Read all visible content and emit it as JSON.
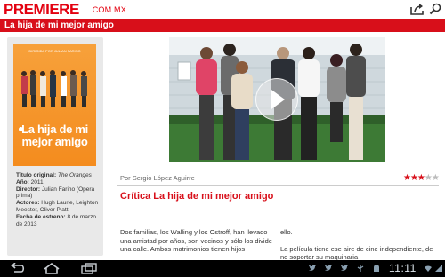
{
  "header": {
    "brand": "PREMIERE",
    "brand_suffix": ".COM.MX"
  },
  "titlebar": {
    "title": "La hija de mi mejor amigo"
  },
  "poster": {
    "tagline": "DIRIGIDA POR JULIAN FARINO",
    "title_line1": "La hija de mi",
    "title_line2": "mejor amigo"
  },
  "info": {
    "original_title_label": "Título original:",
    "original_title": "The Oranges",
    "year_label": "Año:",
    "year": "2011",
    "director_label": "Director:",
    "director": "Julian Farino (Opera prima)",
    "cast_label": "Actores:",
    "cast": "Hugh Laurie, Leighton Meester, Oliver Platt.",
    "release_label": "Fecha de estreno:",
    "release": "8 de marzo de 2013"
  },
  "article": {
    "byline": "Por Sergio López Aguirre",
    "rating": 3,
    "rating_max": 5,
    "headline": "Crítica La hija de mi mejor amigo",
    "col1": "Dos familias, los Walling y los Ostroff, han llevado una amistad por años, son vecinos y sólo los divide una calle. Ambos matrimonios tienen hijos",
    "col2_p1": "ello.",
    "col2_p2": "La película tiene ese aire de cine independiente, de no soportar su maquinaria"
  },
  "status": {
    "time": "11:11"
  },
  "colors": {
    "brand_red": "#e3000f",
    "title_bar": "#d80f1a",
    "system_bar": "#000000"
  },
  "icons": [
    "share-icon",
    "search-icon",
    "play-icon",
    "back-icon",
    "home-icon",
    "recent-apps-icon",
    "twitter-icon",
    "android-icon",
    "usb-icon",
    "wifi-icon",
    "signal-icon"
  ]
}
